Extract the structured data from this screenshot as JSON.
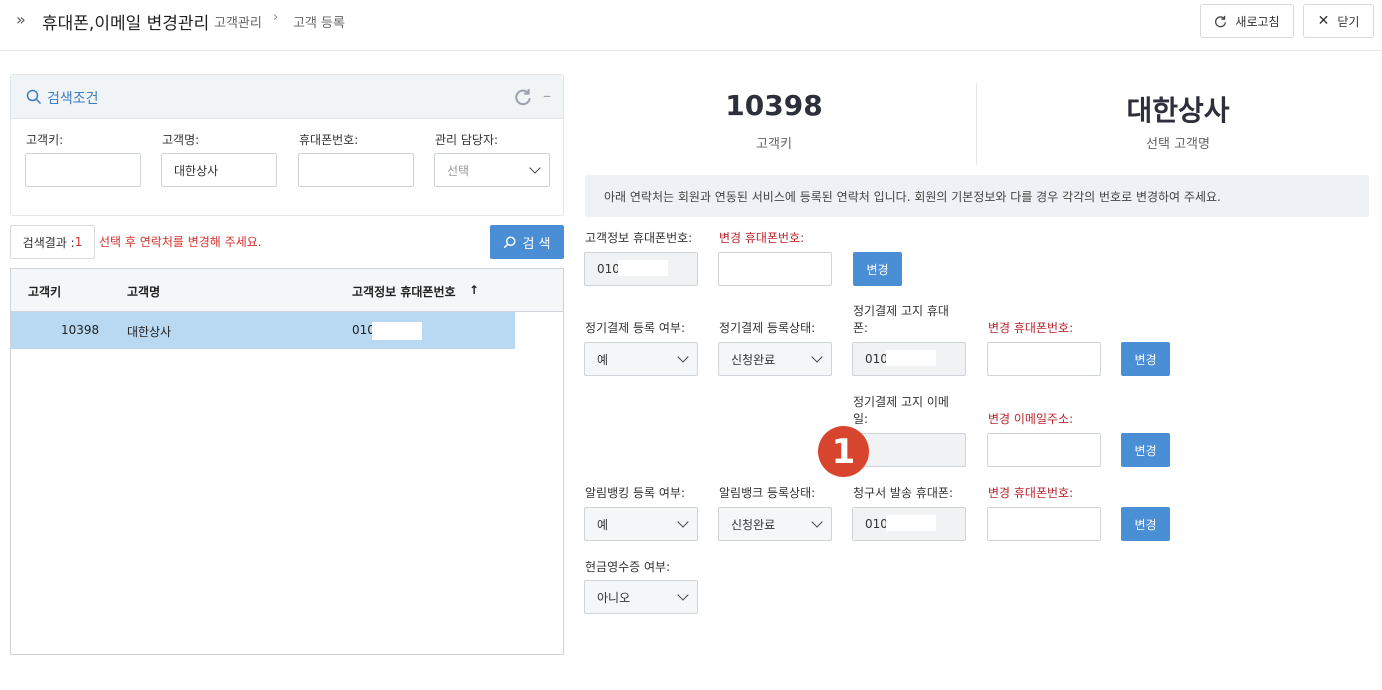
{
  "header": {
    "title": "휴대폰,이메일 변경관리",
    "breadcrumb": [
      "고객관리",
      "고객 등록"
    ],
    "refresh_label": "새로고침",
    "close_label": "닫기"
  },
  "search_panel": {
    "title": "검색조건",
    "fields": {
      "customer_key": {
        "label": "고객키:",
        "value": ""
      },
      "customer_name": {
        "label": "고객명:",
        "value": "대한상사"
      },
      "phone": {
        "label": "휴대폰번호:",
        "value": ""
      },
      "manager": {
        "label": "관리 담당자:",
        "value": "선택"
      }
    }
  },
  "result": {
    "label": "검색결과 :",
    "count": "1",
    "hint": "선택 후 연락처를 변경해 주세요.",
    "search_button": "검 색"
  },
  "grid": {
    "columns": [
      "고객키",
      "고객명",
      "고객정보 휴대폰번호"
    ],
    "sort_indicator": "↑",
    "rows": [
      {
        "key": "10398",
        "name": "대한상사",
        "phone": "010"
      }
    ]
  },
  "summary": {
    "customer_key": "10398",
    "customer_key_label": "고객키",
    "customer_name": "대한상사",
    "customer_name_label": "선택 고객명"
  },
  "notice": "아래 연락처는 회원과 연동된 서비스에 등록된 연락처 입니다. 회원의 기본정보와 다를 경우 각각의 번호로 변경하여 주세요.",
  "form": {
    "info_phone": {
      "label": "고객정보 휴대폰번호:",
      "value": "010"
    },
    "change_phone_1": {
      "label": "변경 휴대폰번호:",
      "value": ""
    },
    "change_button": "변경",
    "recurring_reg": {
      "label": "정기결제 등록 여부:",
      "value": "예"
    },
    "recurring_status": {
      "label": "정기결제 등록상태:",
      "value": "신청완료"
    },
    "recurring_notice_phone": {
      "label_line1": "정기결제 고지 휴대",
      "label_line2": "폰:",
      "value": "010"
    },
    "change_phone_2": {
      "label": "변경 휴대폰번호:",
      "value": ""
    },
    "recurring_notice_email": {
      "label_line1": "정기결제 고지 이메",
      "label_line2": "일:",
      "value": ""
    },
    "change_email": {
      "label": "변경 이메일주소:",
      "value": ""
    },
    "alimbank_reg": {
      "label": "알림뱅킹 등록 여부:",
      "value": "예"
    },
    "alimbank_status": {
      "label": "알림뱅크 등록상태:",
      "value": "신청완료"
    },
    "invoice_phone": {
      "label": "청구서 발송 휴대폰:",
      "value": "010"
    },
    "change_phone_3": {
      "label": "변경 휴대폰번호:",
      "value": ""
    },
    "cash_receipt": {
      "label": "현금영수증 여부:",
      "value": "아니오"
    }
  },
  "annotation_badge": "1",
  "colors": {
    "accent": "#4a8fd6",
    "selected_row": "#b9d9f2",
    "warning": "#d0312d",
    "badge": "#d8452e"
  }
}
